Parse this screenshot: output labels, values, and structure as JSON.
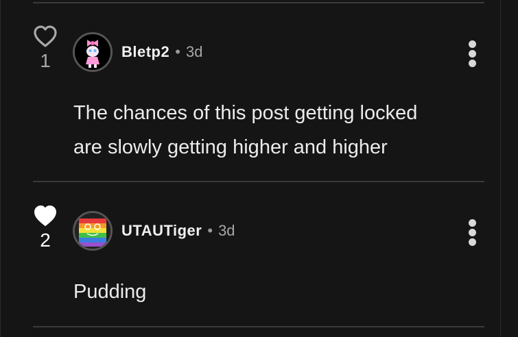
{
  "comments": [
    {
      "username": "Bletp2",
      "separator": "•",
      "time": "3d",
      "likes": "1",
      "liked": false,
      "text_lines": [
        "The chances of this post getting locked",
        "are slowly getting higher and higher"
      ],
      "avatar_icon": "pink-bow-character-icon"
    },
    {
      "username": "UTAUTiger",
      "separator": "•",
      "time": "3d",
      "likes": "2",
      "liked": true,
      "text_lines": [
        "Pudding"
      ],
      "avatar_icon": "rainbow-pride-character-icon"
    }
  ],
  "colors": {
    "background": "#151515",
    "divider": "#3a3a3a",
    "text": "#ececec",
    "muted": "#a8a8a8"
  }
}
